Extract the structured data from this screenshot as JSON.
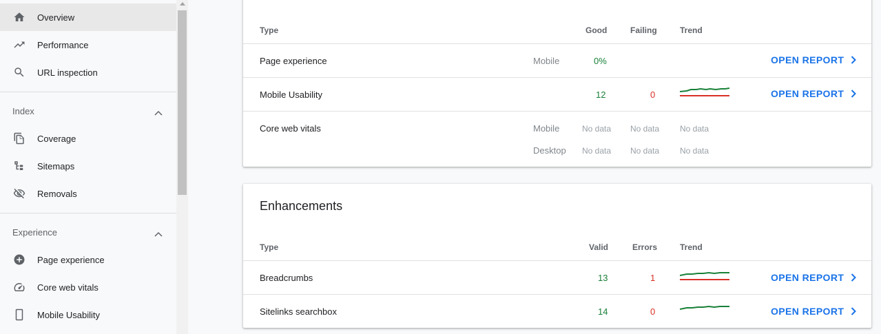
{
  "sidebar": {
    "items_top": [
      {
        "label": "Overview",
        "icon": "home-icon",
        "active": true
      },
      {
        "label": "Performance",
        "icon": "trending-up-icon"
      },
      {
        "label": "URL inspection",
        "icon": "search-icon"
      }
    ],
    "index": {
      "label": "Index",
      "items": [
        {
          "label": "Coverage",
          "icon": "file-copy-icon"
        },
        {
          "label": "Sitemaps",
          "icon": "sitemap-icon"
        },
        {
          "label": "Removals",
          "icon": "visibility-off-icon"
        }
      ]
    },
    "experience": {
      "label": "Experience",
      "items": [
        {
          "label": "Page experience",
          "icon": "add-circle-icon"
        },
        {
          "label": "Core web vitals",
          "icon": "speed-gauge-icon"
        },
        {
          "label": "Mobile Usability",
          "icon": "smartphone-icon"
        }
      ]
    }
  },
  "experience_card": {
    "headers": {
      "type": "Type",
      "good": "Good",
      "failing": "Failing",
      "trend": "Trend"
    },
    "rows": {
      "page_experience": {
        "type": "Page experience",
        "device": "Mobile",
        "good": "0%",
        "open": "OPEN REPORT"
      },
      "mobile_usability": {
        "type": "Mobile Usability",
        "good": "12",
        "failing": "0",
        "open": "OPEN REPORT"
      },
      "core_web_vitals": {
        "type": "Core web vitals",
        "mobile": {
          "device": "Mobile",
          "good": "No data",
          "failing": "No data",
          "trend": "No data"
        },
        "desktop": {
          "device": "Desktop",
          "good": "No data",
          "failing": "No data",
          "trend": "No data"
        }
      }
    }
  },
  "enhancements_card": {
    "title": "Enhancements",
    "headers": {
      "type": "Type",
      "valid": "Valid",
      "errors": "Errors",
      "trend": "Trend"
    },
    "rows": {
      "breadcrumbs": {
        "type": "Breadcrumbs",
        "valid": "13",
        "errors": "1",
        "open": "OPEN REPORT"
      },
      "sitelinks": {
        "type": "Sitelinks searchbox",
        "valid": "14",
        "errors": "0",
        "open": "OPEN REPORT"
      }
    }
  },
  "colors": {
    "good": "#188038",
    "bad": "#d93025",
    "link": "#1a73e8"
  }
}
